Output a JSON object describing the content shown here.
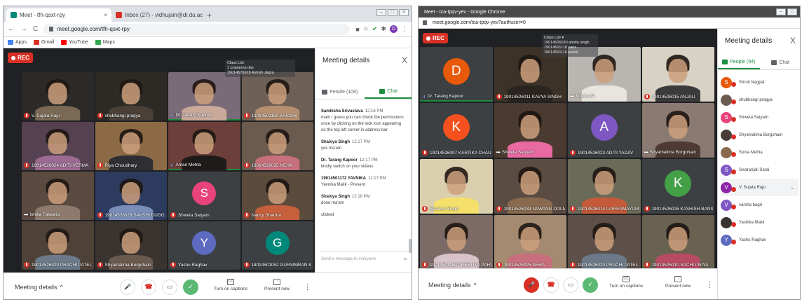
{
  "left": {
    "tabs": [
      {
        "title": "Meet - tfh-qsxt-rpy",
        "icon_color": "#00897b",
        "active": true
      },
      {
        "title": "Inbox (27) - vidhujain@dr.du.ac.in",
        "icon_color": "#d93025",
        "active": false
      }
    ],
    "new_tab": "+",
    "window_controls": [
      "–",
      "□",
      "×"
    ],
    "url": "meet.google.com/tfh-qsxt-rpy",
    "profile_letter": "D",
    "bookmarks": [
      {
        "label": "Apps",
        "color": "#4285f4"
      },
      {
        "label": "Gmail",
        "color": "#d93025"
      },
      {
        "label": "YouTube",
        "color": "#ff0000"
      },
      {
        "label": "Maps",
        "color": "#34a853"
      }
    ],
    "rec": "REC",
    "tiles": [
      {
        "name": "V. Sujata Raju",
        "muted": true,
        "kind": "video",
        "bg": "#2b2a28",
        "shirt": "#7a6a55"
      },
      {
        "name": "shubhangi pragya",
        "muted": true,
        "kind": "video",
        "bg": "#2d2a26",
        "shirt": "#4a4038"
      },
      {
        "name": "Dr. Tarang Kapoor",
        "muted": false,
        "speaking": true,
        "kind": "video",
        "bg": "#7a6b78",
        "shirt": "#c8a99a"
      },
      {
        "name": "19014501160 KARISHI",
        "muted": true,
        "kind": "video",
        "bg": "#6e5f57",
        "shirt": "#b58f6f"
      },
      {
        "name": "19014526024 ADITI VERMA",
        "muted": true,
        "kind": "video",
        "bg": "#55414f",
        "shirt": "#9b6b92"
      },
      {
        "name": "Riya Choudhary",
        "muted": true,
        "kind": "video",
        "bg": "#8c6a46",
        "shirt": "#2f2f33"
      },
      {
        "name": "Aman Mehta",
        "muted": false,
        "speaking": true,
        "kind": "video",
        "bg": "#6d3f3a",
        "shirt": "#1f1b1a"
      },
      {
        "name": "19014526025 NEHA",
        "muted": true,
        "kind": "video",
        "bg": "#6b5a4e",
        "shirt": "#c86f7c"
      },
      {
        "name": "Ishika Falwaria",
        "muted": false,
        "kind": "video",
        "bg": "#5a4a40",
        "shirt": "#8f7b6e"
      },
      {
        "name": "19014526029 SAKSHI DUGG...",
        "muted": true,
        "kind": "video",
        "bg": "#2d3b5e",
        "shirt": "#7a8db8"
      },
      {
        "name": "Shweta Satyam",
        "muted": true,
        "kind": "avatar",
        "letter": "S",
        "color": "#e8437a"
      },
      {
        "name": "Nancy Sharma",
        "muted": true,
        "kind": "video",
        "bg": "#5b4b3c",
        "shirt": "#c65f3c"
      },
      {
        "name": "19014526020 PRACHI PATEL",
        "muted": true,
        "kind": "video",
        "bg": "#4e4238",
        "shirt": "#6b7a8a"
      },
      {
        "name": "Shyamalima Borgohain",
        "muted": true,
        "kind": "video",
        "bg": "#3a3430",
        "shirt": "#6a5a4e"
      },
      {
        "name": "Yashu Raghav",
        "muted": true,
        "kind": "avatar",
        "letter": "Y",
        "color": "#5c6bc0"
      },
      {
        "name": "18014501052 GURSIMRAN K...",
        "muted": true,
        "kind": "avatar",
        "letter": "G",
        "color": "#00897b"
      }
    ],
    "overlay_text": [
      "Class List",
      "1 prasanna das",
      "19014526028 Ashish Jagra"
    ],
    "panel": {
      "title": "Meeting details",
      "close": "X",
      "tab_people": "People (108)",
      "tab_chat": "Chat",
      "messages": [
        {
          "sender": "Samiksha Srivastava",
          "time": "12:16 PM",
          "text": "mam i guess you can check the permissions once by clicking on the lock icon appearing on the top left corner in address bar"
        },
        {
          "sender": "Shaivya Singh",
          "time": "12:17 PM",
          "text": "yes ma'am"
        },
        {
          "sender": "Dr. Tarang Kapoor",
          "time": "12:17 PM",
          "text": "kindly switch on your videos"
        },
        {
          "sender": "19014501172 YAVNIKA",
          "time": "12:17 PM",
          "text": "Yavnika Malik - Present"
        },
        {
          "sender": "Shaivya Singh",
          "time": "12:18 PM",
          "text": "done ma'am"
        },
        {
          "sender": "",
          "time": "",
          "text": "clicked"
        }
      ],
      "input_placeholder": "Send a message to everyone",
      "send_icon": "►"
    },
    "bottom": {
      "meeting_details": "Meeting details",
      "caret": "^",
      "captions_label": "Turn on captions",
      "captions_icon": "CC",
      "present_label": "Present now",
      "present_icon": "↑",
      "more_icon": "⋮",
      "mic_icon": "🎤",
      "end_icon": "☎",
      "cam_icon": "▭",
      "check_icon": "✓"
    }
  },
  "right": {
    "tab_title": "Meet - tca-tpqv-yev - Google Chrome",
    "window_controls": [
      "–",
      "□"
    ],
    "url": "meet.google.com/tca-tpqv-yev?authuser=0",
    "rec": "REC",
    "overlay_text": [
      "Class List ▾",
      "19014526030 ahsita singh",
      "19014501118 sana",
      "19014501116 preeti"
    ],
    "tiles": [
      {
        "name": "Dr. Tarang Kapoor",
        "muted": false,
        "speaking": true,
        "kind": "avatar",
        "letter": "D",
        "color": "#e8590c"
      },
      {
        "name": "19014526011 KAVYA SINGH",
        "muted": true,
        "kind": "video",
        "bg": "#3c3228",
        "shirt": "#2a2420"
      },
      {
        "name": "Monica P.",
        "muted": false,
        "kind": "video",
        "bg": "#b9b5b0",
        "shirt": "#e8e4de"
      },
      {
        "name": "19014526015 ANJALI",
        "muted": true,
        "kind": "video",
        "bg": "#d8d2c4",
        "shirt": "#3b3b3b"
      },
      {
        "name": "19014526007 KARTIKA CHAUDH...",
        "muted": true,
        "kind": "avatar",
        "letter": "K",
        "color": "#f4511e"
      },
      {
        "name": "Shweta Satyam",
        "muted": false,
        "kind": "video",
        "bg": "#4a3a30",
        "shirt": "#e86aa0"
      },
      {
        "name": "19014526023 ADITI YADAV",
        "muted": true,
        "kind": "avatar",
        "letter": "A",
        "color": "#7e57c2"
      },
      {
        "name": "Shyamalima Borgohain",
        "muted": false,
        "kind": "video",
        "bg": "#8a7a72",
        "shirt": "#4e3a34"
      },
      {
        "name": "Shaivya Singh",
        "muted": true,
        "kind": "video",
        "bg": "#d9cfae",
        "shirt": "#f4e06a"
      },
      {
        "name": "19014526033 NAWANG DOLMA",
        "muted": true,
        "kind": "video",
        "bg": "#5a4c42",
        "shirt": "#8a6a4e"
      },
      {
        "name": "19014526014 LAIRENMAYUM MI...",
        "muted": true,
        "kind": "video",
        "bg": "#6a6a58",
        "shirt": "#c45a3a"
      },
      {
        "name": "19014526026 KASHISH BANSAL",
        "muted": true,
        "kind": "avatar",
        "letter": "K",
        "color": "#43a047"
      },
      {
        "name": "19014501159 PREETIKA PAHWA",
        "muted": true,
        "kind": "video",
        "bg": "#7b6a66",
        "shirt": "#d9c2c8"
      },
      {
        "name": "19014526025 NEHA",
        "muted": true,
        "kind": "video",
        "bg": "#a38a70",
        "shirt": "#c86f7c"
      },
      {
        "name": "19014526020 PRACHI PATEL",
        "muted": true,
        "kind": "video",
        "bg": "#5d5048",
        "shirt": "#6b7a8a"
      },
      {
        "name": "19014526010 SACHI PRIYA",
        "muted": true,
        "kind": "video",
        "bg": "#6a6250",
        "shirt": "#b84a64"
      }
    ],
    "panel": {
      "title": "Meeting details",
      "close": "X",
      "tab_people": "People (94)",
      "tab_chat": "Chat",
      "people": [
        {
          "name": "Shruti Nagpal",
          "letter": "S",
          "color": "#e8590c"
        },
        {
          "name": "shubhangi pragya",
          "letter": "",
          "color": "#6b5a4e"
        },
        {
          "name": "Shweta Satyam",
          "letter": "S",
          "color": "#e8437a"
        },
        {
          "name": "Shyamalima Borgohain",
          "letter": "",
          "color": "#4a3f38"
        },
        {
          "name": "Sonia Mehta",
          "letter": "",
          "color": "#8a6a4e"
        },
        {
          "name": "Swaranjali Sarai",
          "letter": "S",
          "color": "#7e57c2"
        },
        {
          "name": "V. Sujata Raju",
          "letter": "V",
          "color": "#8e24aa",
          "selected": true
        },
        {
          "name": "varsha bagri",
          "letter": "V",
          "color": "#7e57c2"
        },
        {
          "name": "Yashika Malik",
          "letter": "",
          "color": "#3a3430"
        },
        {
          "name": "Yashu Raghav",
          "letter": "Y",
          "color": "#5c6bc0"
        }
      ],
      "chevron": "⌄"
    },
    "bottom": {
      "meeting_details": "Meeting details",
      "caret": "^",
      "captions_label": "Turn on captions",
      "captions_icon": "CC",
      "present_label": "Present now",
      "present_icon": "↑",
      "more_icon": "⋮",
      "mic_icon": "🎤",
      "end_icon": "☎",
      "cam_icon": "▭",
      "check_icon": "✓"
    }
  }
}
